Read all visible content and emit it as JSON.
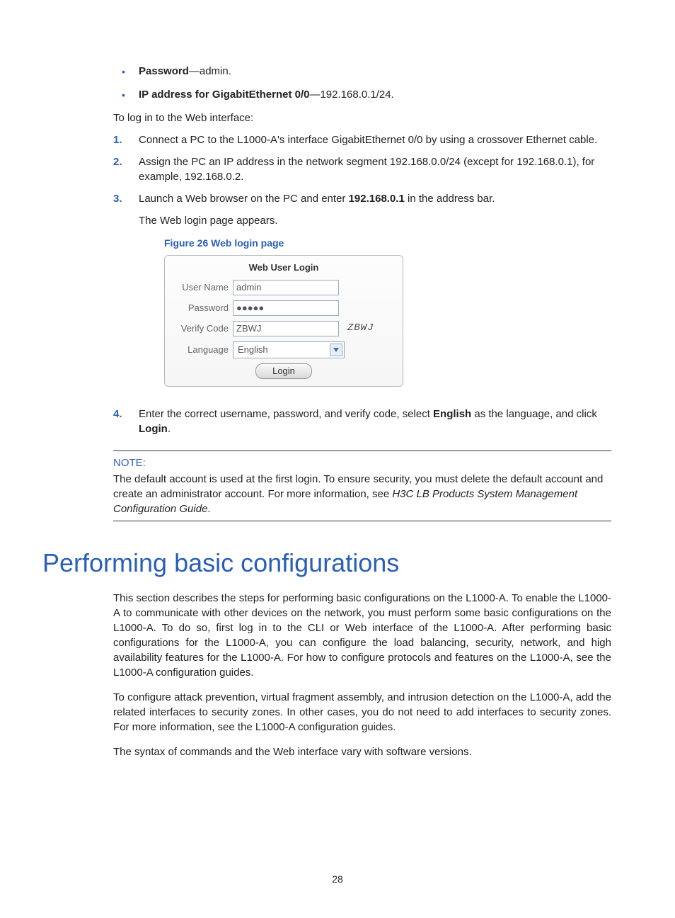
{
  "bullets": [
    {
      "strong": "Password",
      "rest": "—admin."
    },
    {
      "strong": "IP address for GigabitEthernet 0/0",
      "rest": "—192.168.0.1/24."
    }
  ],
  "intro": "To log in to the Web interface:",
  "steps": {
    "s1": {
      "num": "1.",
      "text": "Connect a PC to the L1000-A's interface GigabitEthernet 0/0 by using a crossover Ethernet cable."
    },
    "s2": {
      "num": "2.",
      "text": "Assign the PC an IP address in the network segment 192.168.0.0/24 (except for 192.168.0.1), for example, 192.168.0.2."
    },
    "s3": {
      "num": "3.",
      "pre": "Launch a Web browser on the PC and enter ",
      "strong": "192.168.0.1",
      "post": " in the address bar.",
      "sub": "The Web login page appears."
    },
    "s4": {
      "num": "4.",
      "pre": "Enter the correct username, password, and verify code, select ",
      "strong1": "English",
      "mid": " as the language, and click ",
      "strong2": "Login",
      "post": "."
    }
  },
  "figure_caption": "Figure 26 Web login page",
  "login": {
    "title": "Web User Login",
    "username_label": "User Name",
    "username_value": "admin",
    "password_label": "Password",
    "password_value": "●●●●●",
    "verify_label": "Verify Code",
    "verify_value": "ZBWJ",
    "captcha": "ZBWJ",
    "language_label": "Language",
    "language_value": "English",
    "login_button": "Login"
  },
  "note": {
    "label": "NOTE:",
    "body_pre": "The default account is used at the first login. To ensure security, you must delete the default account and create an administrator account. For more information, see ",
    "italic": "H3C LB Products System Management Configuration Guide",
    "body_post": "."
  },
  "section_title": "Performing basic configurations",
  "paragraphs": {
    "p1": "This section describes the steps for performing basic configurations on the L1000-A. To enable the L1000-A to communicate with other devices on the network, you must perform some basic configurations on the L1000-A. To do so, first log in to the CLI or Web interface of the L1000-A. After performing basic configurations for the L1000-A, you can configure the load balancing, security, network, and high availability features for the L1000-A. For how to configure protocols and features on the L1000-A, see the L1000-A configuration guides.",
    "p2": "To configure attack prevention, virtual fragment assembly, and intrusion detection on the L1000-A, add the related interfaces to security zones. In other cases, you do not need to add interfaces to security zones. For more information, see the L1000-A configuration guides.",
    "p3": "The syntax of commands and the Web interface vary with software versions."
  },
  "page_number": "28"
}
